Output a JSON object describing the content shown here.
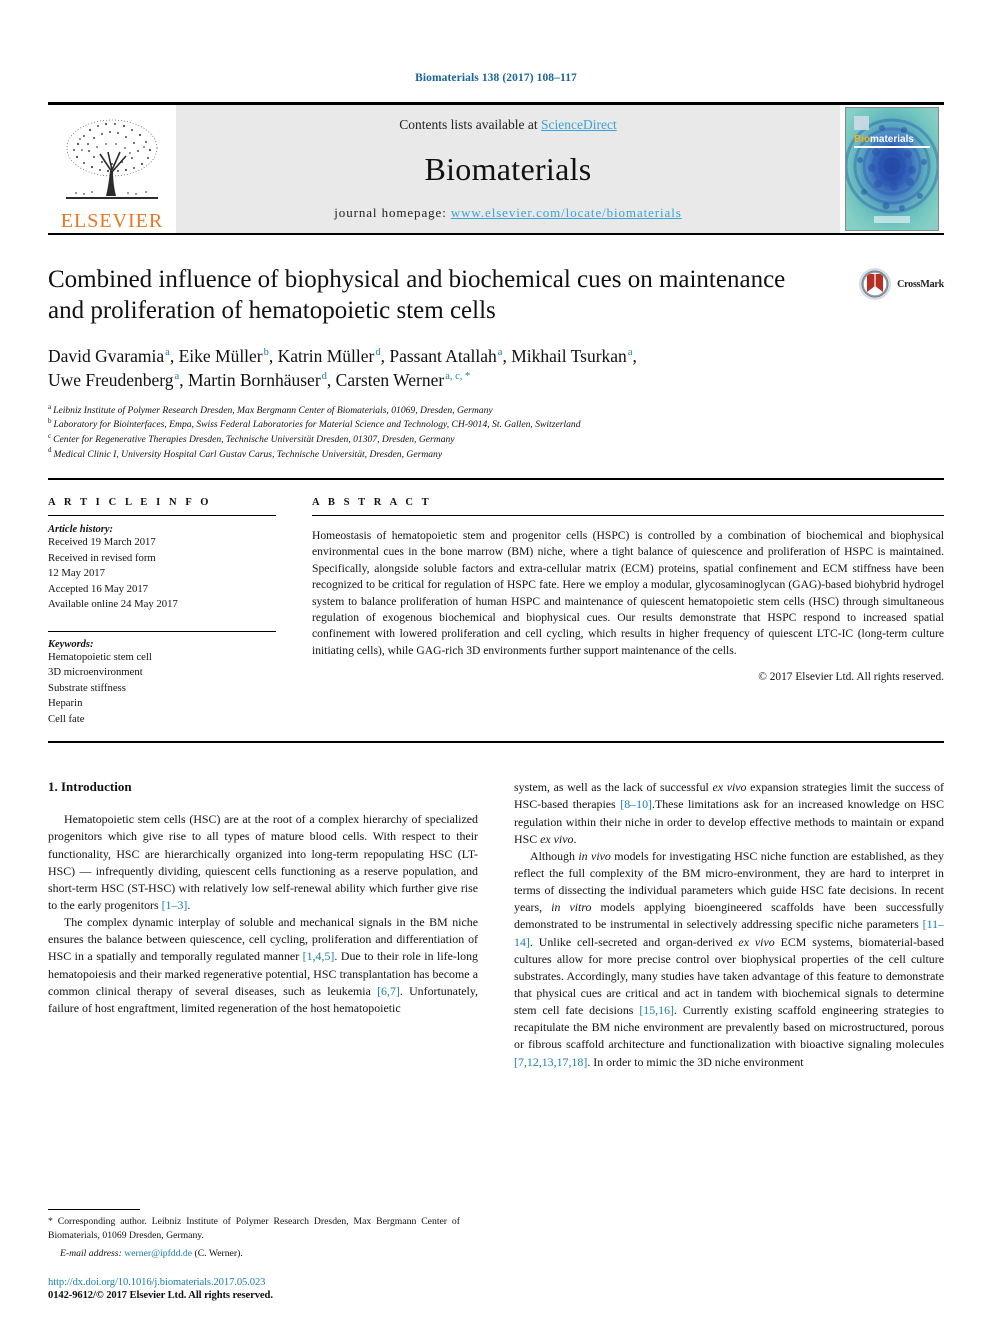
{
  "running_head": "Biomaterials 138 (2017) 108–117",
  "header": {
    "publisher_name": "ELSEVIER",
    "contents_prefix": "Contents lists available at ",
    "sciencedirect": "ScienceDirect",
    "journal_name": "Biomaterials",
    "homepage_label": "journal homepage: ",
    "homepage_url": "www.elsevier.com/locate/biomaterials",
    "cover_title_bio": "Bio",
    "cover_title_materials": "materials"
  },
  "article": {
    "title": "Combined influence of biophysical and biochemical cues on maintenance and proliferation of hematopoietic stem cells",
    "crossmark_label": "CrossMark",
    "authors_line1_parts": [
      {
        "name": "David Gvaramia",
        "sup": "a",
        "sep": ", "
      },
      {
        "name": "Eike Müller",
        "sup": "b",
        "sep": ", "
      },
      {
        "name": "Katrin Müller",
        "sup": "d",
        "sep": ", "
      },
      {
        "name": "Passant Atallah",
        "sup": "a",
        "sep": ", "
      },
      {
        "name": "Mikhail Tsurkan",
        "sup": "a",
        "sep": ","
      }
    ],
    "authors_line2_parts": [
      {
        "name": "Uwe Freudenberg",
        "sup": "a",
        "sep": ", "
      },
      {
        "name": "Martin Bornhäuser",
        "sup": "d",
        "sep": ", "
      },
      {
        "name": "Carsten Werner",
        "sup": "a, c, *",
        "sep": ""
      }
    ],
    "affiliations": [
      {
        "mark": "a",
        "text": "Leibniz Institute of Polymer Research Dresden, Max Bergmann Center of Biomaterials, 01069, Dresden, Germany"
      },
      {
        "mark": "b",
        "text": "Laboratory for Biointerfaces, Empa, Swiss Federal Laboratories for Material Science and Technology, CH-9014, St. Gallen, Switzerland"
      },
      {
        "mark": "c",
        "text": "Center for Regenerative Therapies Dresden, Technische Universität Dresden, 01307, Dresden, Germany"
      },
      {
        "mark": "d",
        "text": "Medical Clinic I, University Hospital Carl Gustav Carus, Technische Universität, Dresden, Germany"
      }
    ]
  },
  "article_info": {
    "heading": "A R T I C L E   I N F O",
    "history_label": "Article history:",
    "history": [
      "Received 19 March 2017",
      "Received in revised form",
      "12 May 2017",
      "Accepted 16 May 2017",
      "Available online 24 May 2017"
    ],
    "keywords_label": "Keywords:",
    "keywords": [
      "Hematopoietic stem cell",
      "3D microenvironment",
      "Substrate stiffness",
      "Heparin",
      "Cell fate"
    ]
  },
  "abstract": {
    "heading": "A B S T R A C T",
    "text": "Homeostasis of hematopoietic stem and progenitor cells (HSPC) is controlled by a combination of biochemical and biophysical environmental cues in the bone marrow (BM) niche, where a tight balance of quiescence and proliferation of HSPC is maintained. Specifically, alongside soluble factors and extra-cellular matrix (ECM) proteins, spatial confinement and ECM stiffness have been recognized to be critical for regulation of HSPC fate. Here we employ a modular, glycosaminoglycan (GAG)-based biohybrid hydrogel system to balance proliferation of human HSPC and maintenance of quiescent hematopoietic stem cells (HSC) through simultaneous regulation of exogenous biochemical and biophysical cues. Our results demonstrate that HSPC respond to increased spatial confinement with lowered proliferation and cell cycling, which results in higher frequency of quiescent LTC-IC (long-term culture initiating cells), while GAG-rich 3D environments further support maintenance of the cells.",
    "copyright": "© 2017 Elsevier Ltd. All rights reserved."
  },
  "introduction": {
    "heading": "1. Introduction",
    "left_p1_a": "Hematopoietic stem cells (HSC) are at the root of a complex hierarchy of specialized progenitors which give rise to all types of mature blood cells. With respect to their functionality, HSC are hierarchically organized into long-term repopulating HSC (LT-HSC) — infrequently dividing, quiescent cells functioning as a reserve population, and short-term HSC (ST-HSC) with relatively low self-renewal ability which further give rise to the early progenitors ",
    "left_p1_ref": "[1–3]",
    "left_p1_b": ".",
    "left_p2_a": "The complex dynamic interplay of soluble and mechanical signals in the BM niche ensures the balance between quiescence, cell cycling, proliferation and differentiation of HSC in a spatially and temporally regulated manner ",
    "left_p2_ref1": "[1,4,5]",
    "left_p2_b": ". Due to their role in life-long hematopoiesis and their marked regenerative potential, HSC transplantation has become a common clinical therapy of several diseases, such as leukemia ",
    "left_p2_ref2": "[6,7]",
    "left_p2_c": ". Unfortunately, failure of host engraftment, limited regeneration of the host hematopoietic",
    "right_p1_a": "system, as well as the lack of successful ",
    "right_p1_ital": "ex vivo",
    "right_p1_b": " expansion strategies limit the success of HSC-based therapies ",
    "right_p1_ref": "[8–10]",
    "right_p1_c": ".These limitations ask for an increased knowledge on HSC regulation within their niche in order to develop effective methods to maintain or expand HSC ",
    "right_p1_ital2": "ex vivo",
    "right_p1_d": ".",
    "right_p2_a": "Although ",
    "right_p2_ital1": "in vivo",
    "right_p2_b": " models for investigating HSC niche function are established, as they reflect the full complexity of the BM micro-environment, they are hard to interpret in terms of dissecting the individual parameters which guide HSC fate decisions. In recent years, ",
    "right_p2_ital2": "in vitro",
    "right_p2_c": " models applying bioengineered scaffolds have been successfully demonstrated to be instrumental in selectively addressing specific niche parameters ",
    "right_p2_ref1": "[11–14]",
    "right_p2_d": ". Unlike cell-secreted and organ-derived ",
    "right_p2_ital3": "ex vivo",
    "right_p2_e": " ECM systems, biomaterial-based cultures allow for more precise control over biophysical properties of the cell culture substrates. Accordingly, many studies have taken advantage of this feature to demonstrate that physical cues are critical and act in tandem with biochemical signals to determine stem cell fate decisions ",
    "right_p2_ref2": "[15,16]",
    "right_p2_f": ". Currently existing scaffold engineering strategies to recapitulate the BM niche environment are prevalently based on microstructured, porous or fibrous scaffold architecture and functionalization with bioactive signaling molecules ",
    "right_p2_ref3": "[7,12,13,17,18]",
    "right_p2_g": ". In order to mimic the 3D niche environment"
  },
  "footnote": {
    "star": "*",
    "text": " Corresponding author. Leibniz Institute of Polymer Research Dresden, Max Bergmann Center of Biomaterials, 01069 Dresden, Germany.",
    "email_label": "E-mail address:",
    "email": "werner@ipfdd.de",
    "email_suffix": " (C. Werner)."
  },
  "page_footer": {
    "doi": "http://dx.doi.org/10.1016/j.biomaterials.2017.05.023",
    "issn_line": "0142-9612/© 2017 Elsevier Ltd. All rights reserved."
  },
  "colors": {
    "link": "#1a7fa8",
    "running_head": "#1a6496",
    "elsevier_orange": "#e87722",
    "sciencedirect": "#3aa3d4",
    "header_band": "#e9e9e9"
  }
}
